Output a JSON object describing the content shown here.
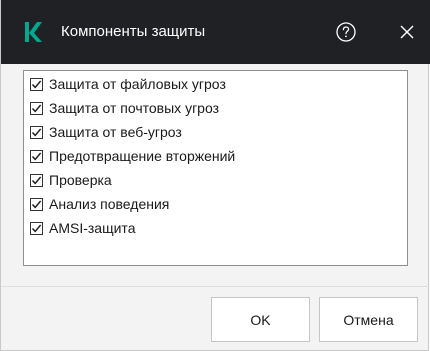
{
  "dialog": {
    "title": "Компоненты защиты",
    "logo_icon": "kaspersky-k-logo",
    "help_icon": "help-circle-icon",
    "close_icon": "close-icon"
  },
  "components": [
    {
      "label": "Защита от файловых угроз",
      "checked": true
    },
    {
      "label": "Защита от почтовых угроз",
      "checked": true
    },
    {
      "label": "Защита от веб-угроз",
      "checked": true
    },
    {
      "label": "Предотвращение вторжений",
      "checked": true
    },
    {
      "label": "Проверка",
      "checked": true
    },
    {
      "label": "Анализ поведения",
      "checked": true
    },
    {
      "label": "AMSI-защита",
      "checked": true
    }
  ],
  "buttons": {
    "ok_label": "OK",
    "cancel_label": "Отмена"
  },
  "colors": {
    "titlebar": "#202124",
    "logo": "#00a88e",
    "background": "#f3f3f3"
  }
}
